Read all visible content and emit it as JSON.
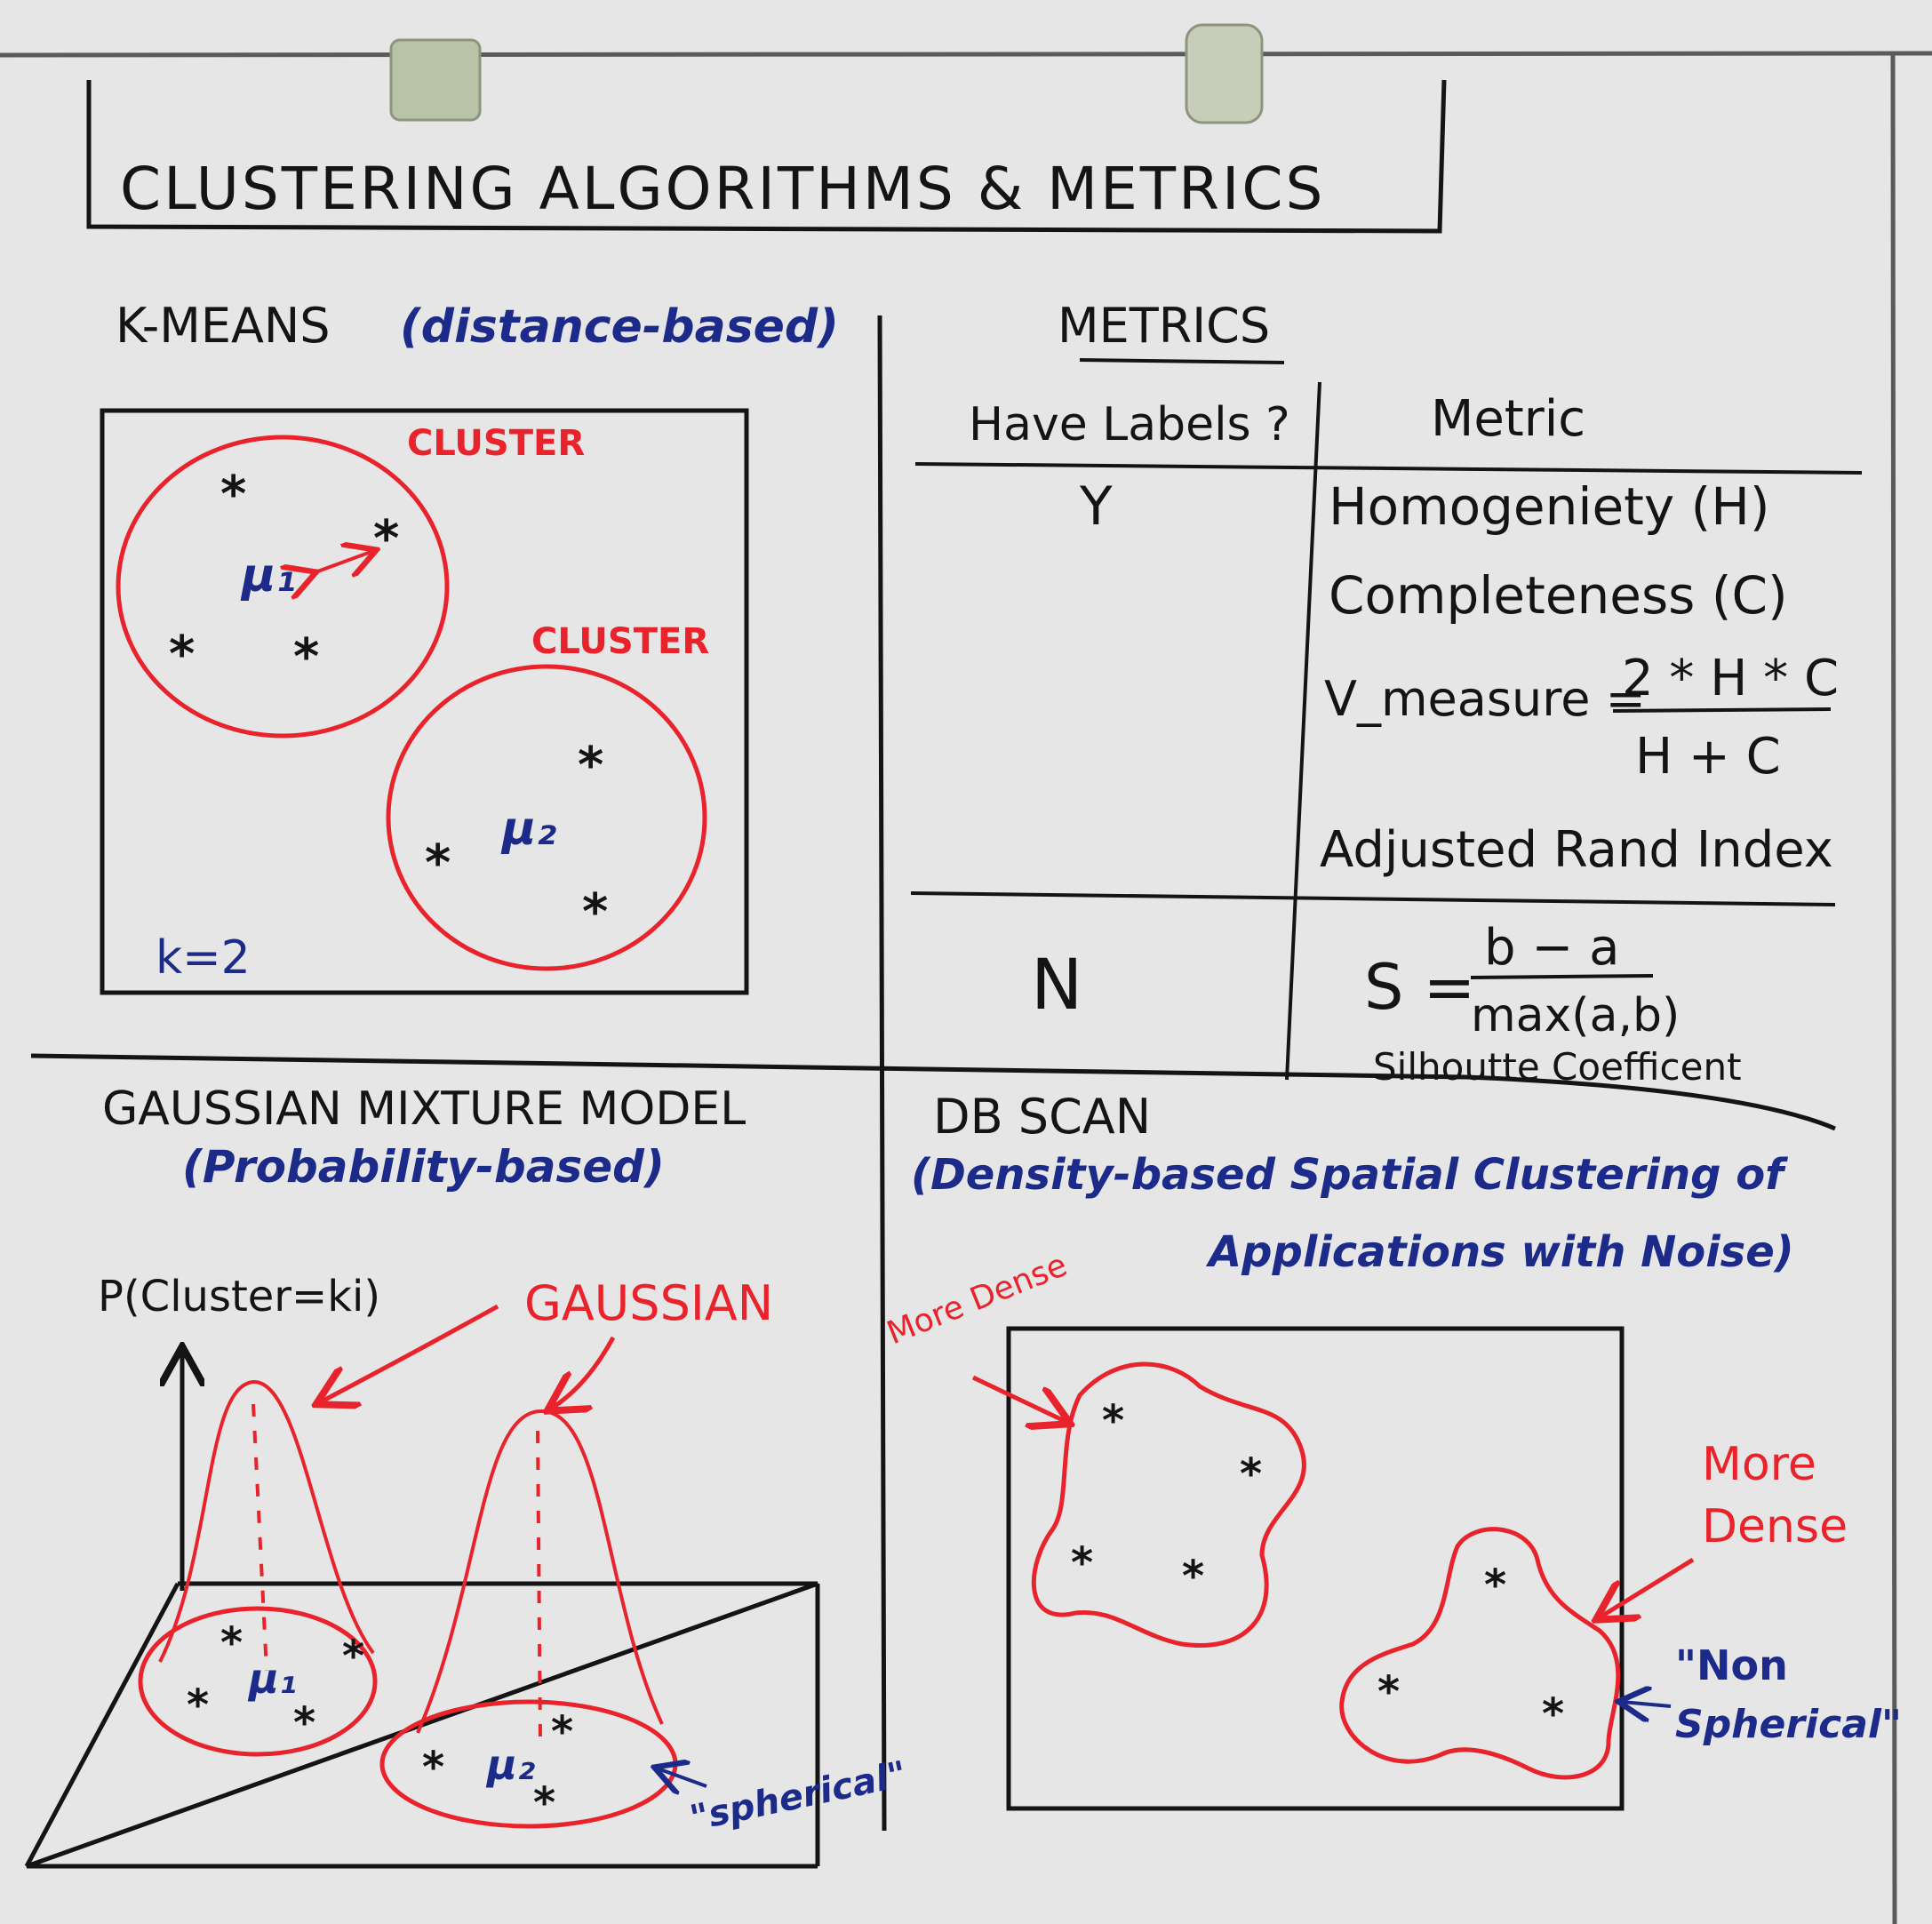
{
  "title": "CLUSTERING  ALGORITHMS & METRICS",
  "kmeans": {
    "heading": "K-MEANS",
    "subtitle": "(distance-based)",
    "cluster_label_1": "CLUSTER",
    "cluster_label_2": "CLUSTER",
    "mu1": "μ₁",
    "mu2": "μ₂",
    "k_label": "k=2"
  },
  "metrics": {
    "heading": "METRICS",
    "col_labels": "Have Labels ?",
    "col_metric": "Metric",
    "row_y": "Y",
    "homogeneity": "Homogeniety (H)",
    "completeness": "Completeness (C)",
    "vmeasure_lhs": "V_measure =",
    "vmeasure_num": "2 * H * C",
    "vmeasure_den": "H + C",
    "ari": "Adjusted Rand Index",
    "row_n": "N",
    "sil_lhs": "S =",
    "sil_num": "b − a",
    "sil_den": "max(a,b)",
    "sil_name": "Silhoutte Coefficent"
  },
  "gmm": {
    "heading": "GAUSSIAN MIXTURE MODEL",
    "subtitle": "(Probability-based)",
    "axis_label": "P(Cluster=ki)",
    "gaussian_label": "GAUSSIAN",
    "mu1": "μ₁",
    "mu2": "μ₂",
    "spherical": "\"spherical\""
  },
  "dbscan": {
    "heading": "DB SCAN",
    "subtitle_line1": "(Density-based Spatial Clustering of",
    "subtitle_line2": "Applications with Noise)",
    "more_dense_1": "More Dense",
    "more_dense_2a": "More",
    "more_dense_2b": "Dense",
    "non_spherical_a": "\"Non",
    "non_spherical_b": "Spherical\""
  },
  "colors": {
    "board": "#e6e6e6",
    "black_marker": "#141414",
    "blue_marker": "#1c2a8a",
    "red_marker": "#e8232c"
  }
}
